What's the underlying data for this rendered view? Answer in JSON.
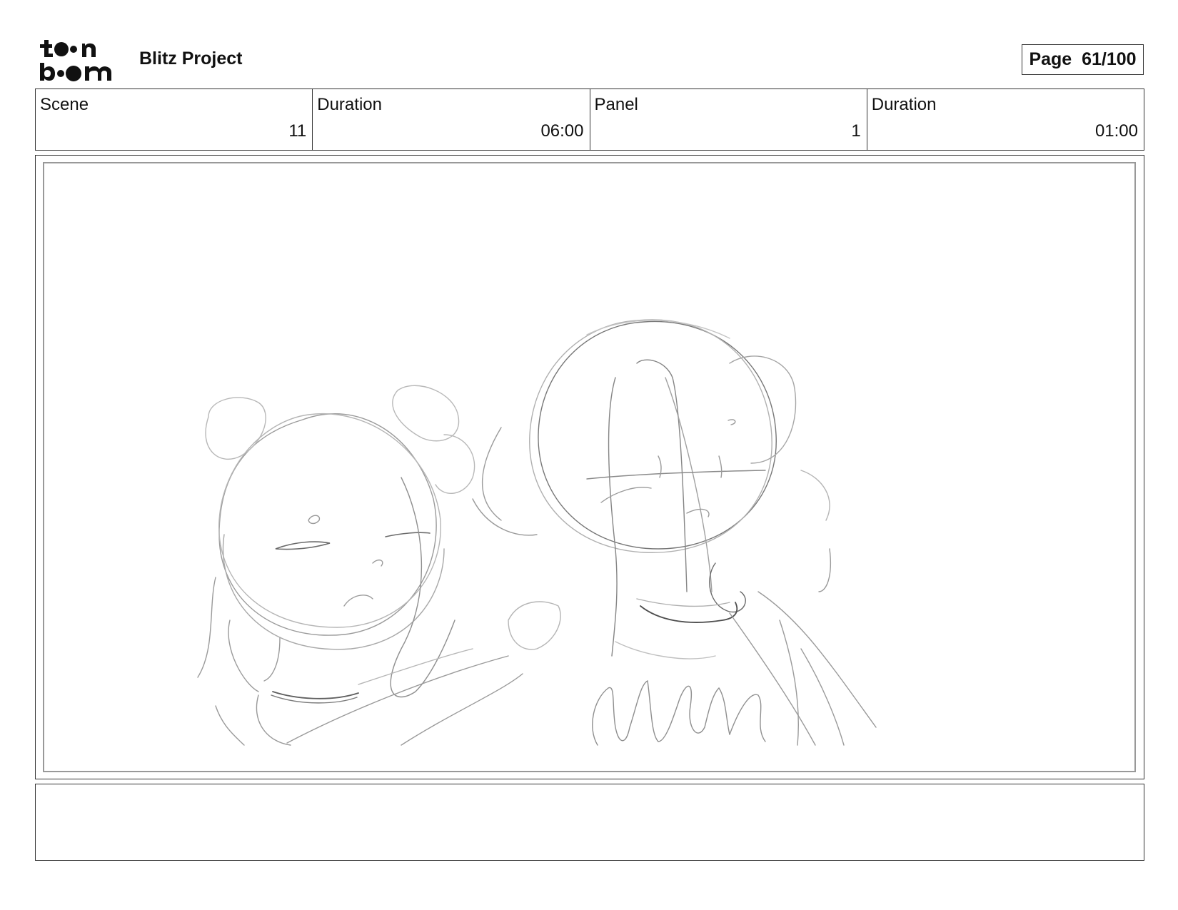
{
  "header": {
    "logo_text": "toon boom",
    "project_title": "Blitz Project",
    "page_label": "Page  61/100"
  },
  "info": {
    "scene_label": "Scene",
    "scene_value": "11",
    "scene_duration_label": "Duration",
    "scene_duration_value": "06:00",
    "panel_label": "Panel",
    "panel_value": "1",
    "panel_duration_label": "Duration",
    "panel_duration_value": "01:00"
  },
  "notes": {
    "text": ""
  }
}
